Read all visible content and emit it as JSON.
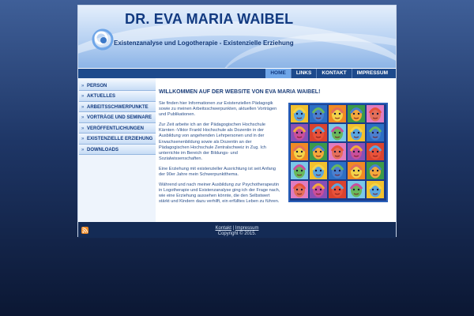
{
  "header": {
    "title": "DR. EVA MARIA WAIBEL",
    "subtitle": "Existenzanalyse und Logotherapie - Existenzielle Erziehung",
    "logo_icon": "swirl-logo-icon"
  },
  "top_nav": {
    "items": [
      {
        "label": "HOME",
        "active": true
      },
      {
        "label": "LINKS",
        "active": false
      },
      {
        "label": "KONTAKT",
        "active": false
      },
      {
        "label": "IMPRESSUM",
        "active": false
      }
    ]
  },
  "sidebar": {
    "items": [
      {
        "label": "PERSON"
      },
      {
        "label": "AKTUELLES"
      },
      {
        "label": "ARBEITSSCHWERPUNKTE"
      },
      {
        "label": "VORTRÄGE UND SEMINARE"
      },
      {
        "label": "VERÖFFENTLICHUNGEN"
      },
      {
        "label": "EXISTENZIELLE ERZIEHUNG"
      },
      {
        "label": "DOWNLOADS"
      }
    ]
  },
  "content": {
    "heading": "WILLKOMMEN AUF DER WEBSITE VON EVA MARIA WAIBEL!",
    "paragraphs": [
      "Sie finden hier Informationen zur Existenziellen Pädagogik sowie zu meinen Arbeitsschwerpunkten, aktuellen Vorträgen und Publikationen.",
      "Zur Zeit arbeite ich an der Pädagogischen Hochschule Kärnten -Viktor Frankl Hochschule als Dozentin in der Ausbildung von angehenden Lehrpersonen und in der Erwachsenenbildung sowie als Dozentin an der Pädagogischen Hochschule Zentralschweiz in Zug. Ich unterrichte im Bereich der Bildungs- und Sozialwissenschaften.",
      "Eine Erziehung mit existenzieller Ausrichtung ist seit Anfang der 90er Jahre mein Schwerpunktthema.",
      "Während und nach meiner Ausbildung zur Psychotherapeutin in Logotherapie und Existenzanalyse ging ich der Frage nach, wie eine Erziehung aussehen könnte, die den Selbstwert stärkt und Kindern dazu verhilft, ein erfülltes Leben zu führen."
    ],
    "artwork_icon": "colorful-faces-artwork"
  },
  "footer": {
    "link_kontakt": "Kontakt",
    "separator": "|",
    "link_impressum": "Impressum",
    "copyright": "Copyright © 2015.",
    "rss_icon": "rss-feed-icon"
  },
  "colors": {
    "accent": "#1d4a8c",
    "active_tab": "#6fa6e8",
    "text": "#2a4f8a"
  }
}
